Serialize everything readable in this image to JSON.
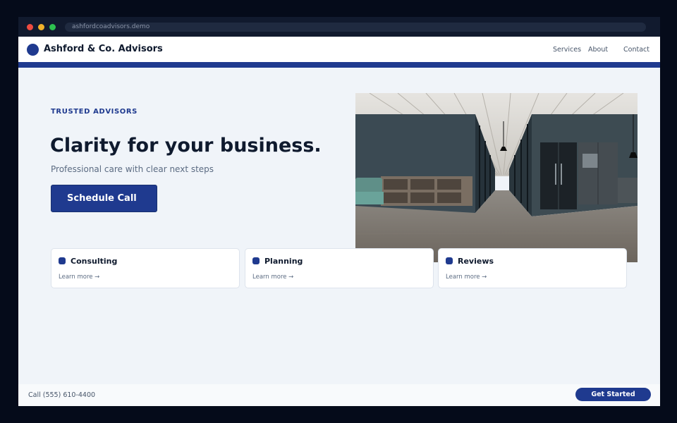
{
  "browser": {
    "url": "ashfordcoadvisors.demo"
  },
  "nav": {
    "brand": "Ashford & Co. Advisors",
    "links": [
      "Services",
      "About",
      "Contact"
    ]
  },
  "hero": {
    "eyebrow": "TRUSTED ADVISORS",
    "title": "Clarity for your business.",
    "subtitle": "Professional care with clear next steps",
    "cta_label": "Schedule Call"
  },
  "cards": [
    {
      "title": "Consulting",
      "link": "Learn more →"
    },
    {
      "title": "Planning",
      "link": "Learn more →"
    },
    {
      "title": "Reviews",
      "link": "Learn more →"
    }
  ],
  "footer": {
    "phone": "Call (555) 610-4400",
    "cta_label": "Get Started"
  },
  "colors": {
    "brand": "#1f3a8f",
    "page_bg": "#f0f4f9",
    "text_dark": "#0f1a2e"
  }
}
